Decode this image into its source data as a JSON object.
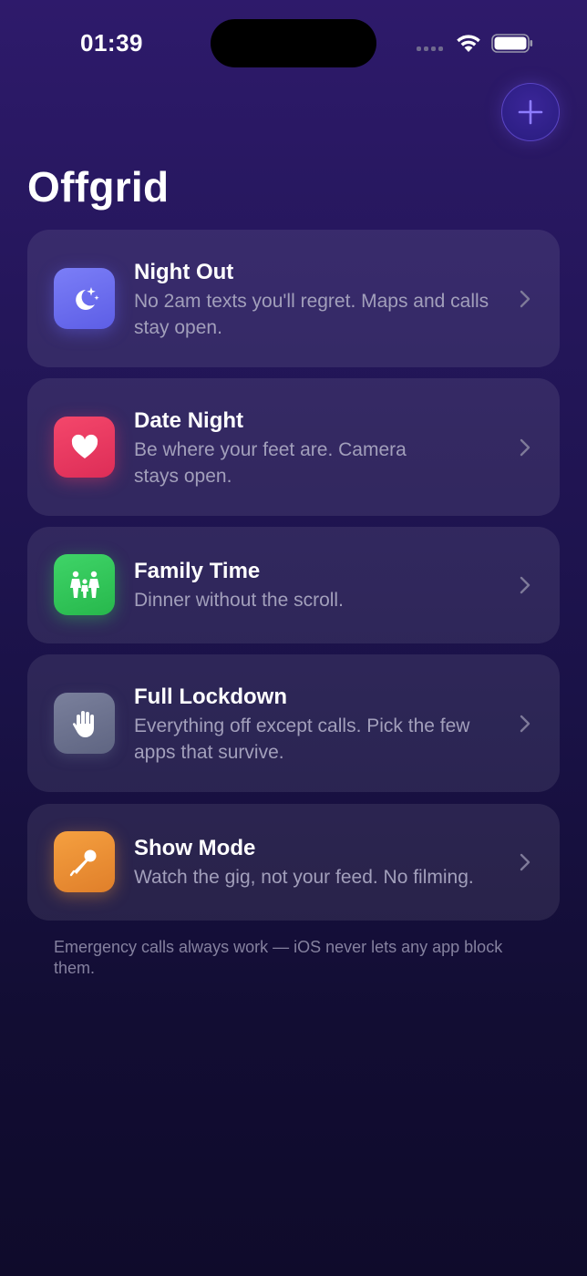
{
  "status_bar": {
    "time": "01:39"
  },
  "header": {
    "title": "Offgrid",
    "add_icon": "plus-icon"
  },
  "modes": [
    {
      "title": "Night Out",
      "description": "No 2am texts you'll regret. Maps and calls stay open.",
      "icon": "moon-stars-icon",
      "color": "#6b6df2"
    },
    {
      "title": "Date Night",
      "description": "Be where your feet are. Camera stays open.",
      "icon": "heart-icon",
      "color": "#ef3b62"
    },
    {
      "title": "Family Time",
      "description": "Dinner without the scroll.",
      "icon": "family-icon",
      "color": "#34c759"
    },
    {
      "title": "Full Lockdown",
      "description": "Everything off except calls. Pick the few apps that survive.",
      "icon": "hand-raised-icon",
      "color": "#6c7390"
    },
    {
      "title": "Show Mode",
      "description": "Watch the gig, not your feed. No filming.",
      "icon": "microphone-icon",
      "color": "#f0963a"
    }
  ],
  "footnote": "Emergency calls always work — iOS never lets any app block them.",
  "colors": {
    "accent": "#7d6bff",
    "background_top": "#2e1a6b",
    "background_bottom": "#0f0b2b"
  }
}
